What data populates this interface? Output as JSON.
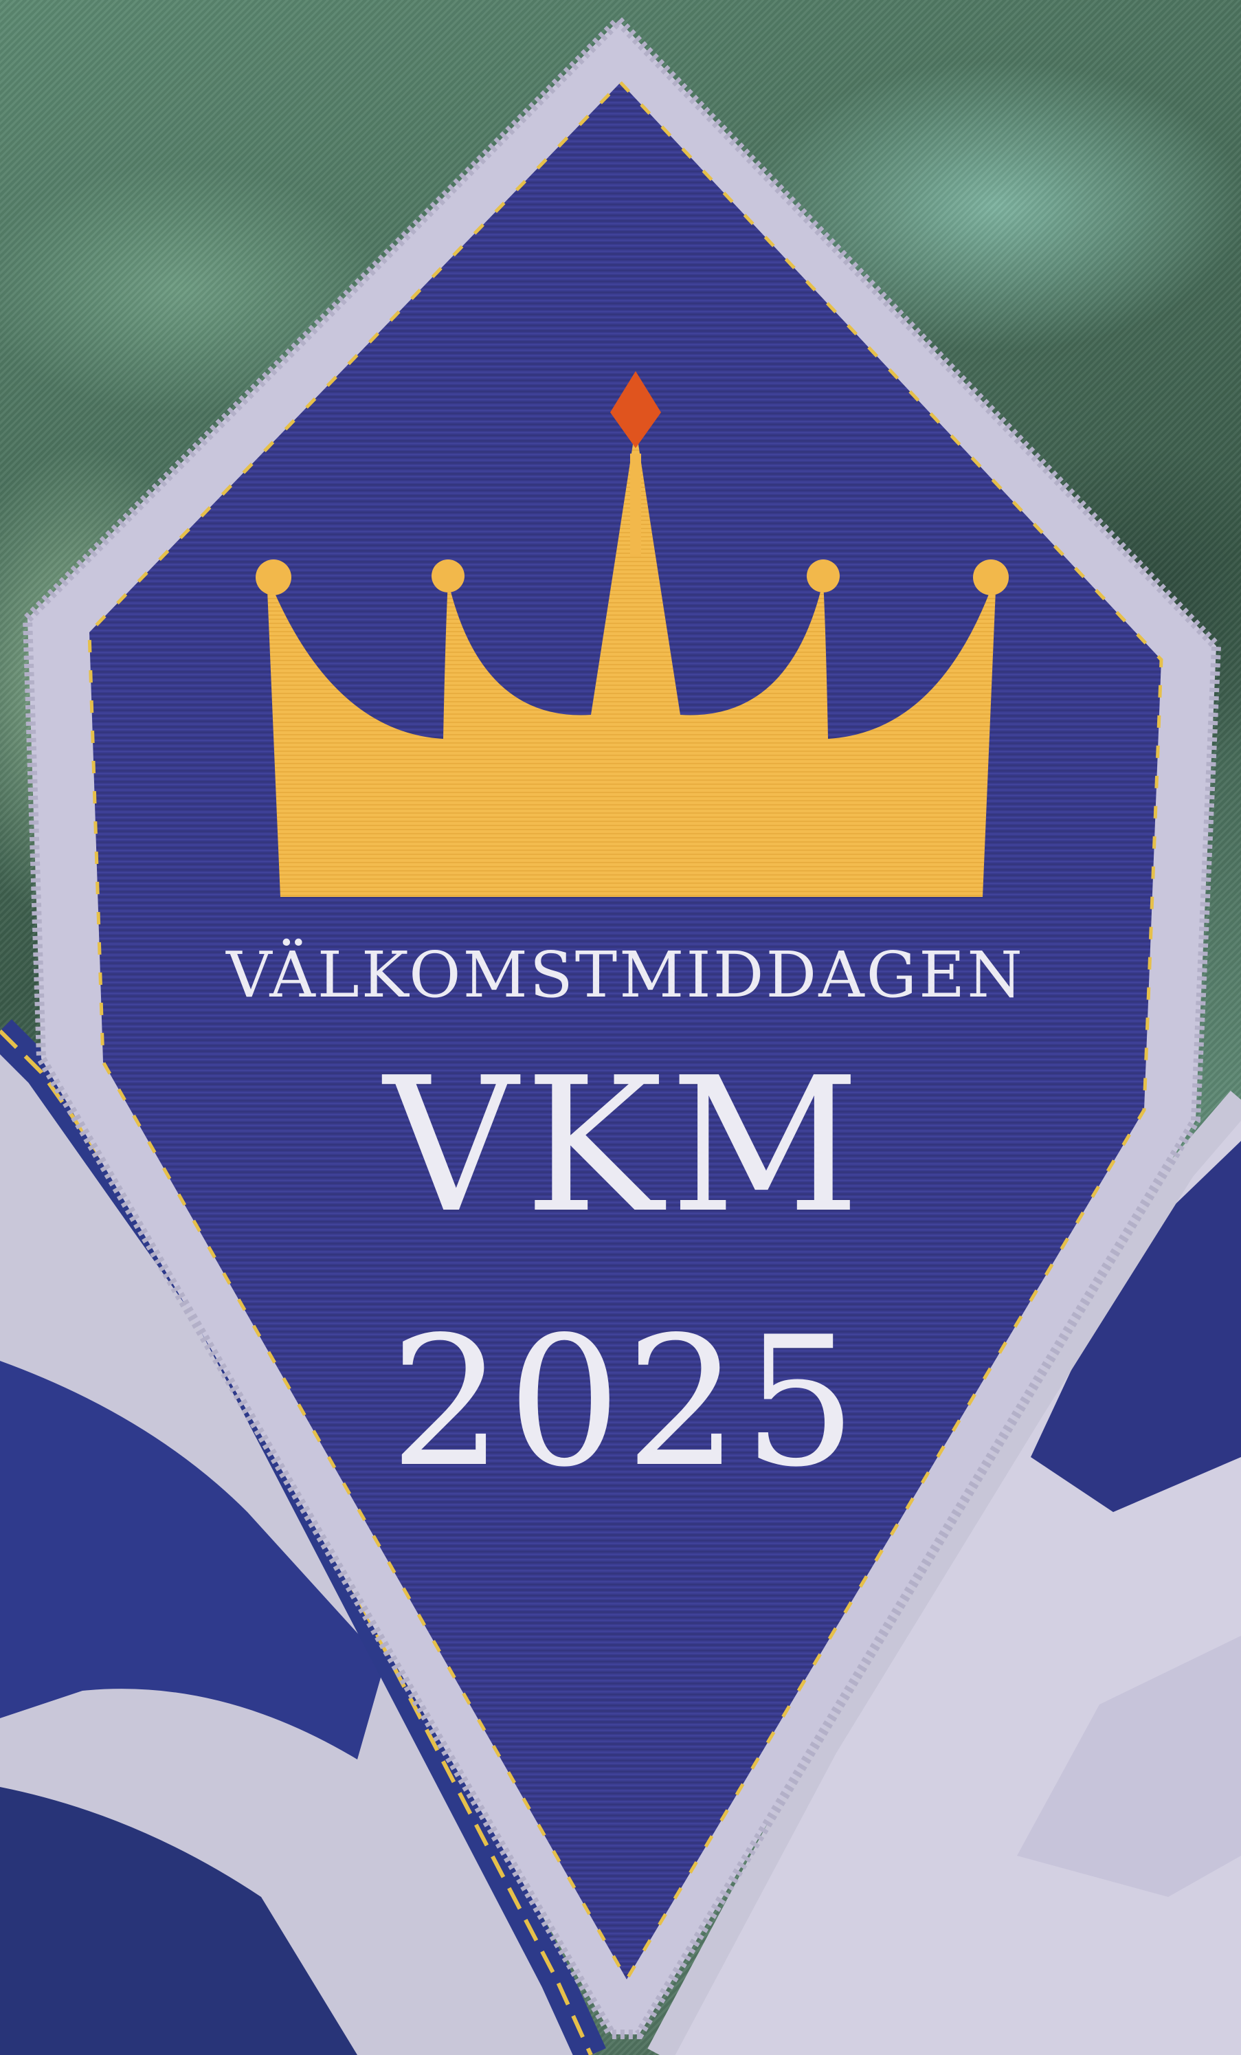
{
  "patch": {
    "subtitle": "VÄLKOMSTMIDDAGEN",
    "title": "VKM",
    "year": "2025"
  },
  "colors": {
    "patch_navy": "#3a3c8f",
    "crown_gold": "#f2b84b",
    "jewel_orange": "#e0541e",
    "border_lilac": "#c9c6dc",
    "stitch_yellow": "#e6c04a",
    "fabric_green": "#5d8a72"
  },
  "icons": [
    "crown-icon",
    "jewel-icon"
  ]
}
